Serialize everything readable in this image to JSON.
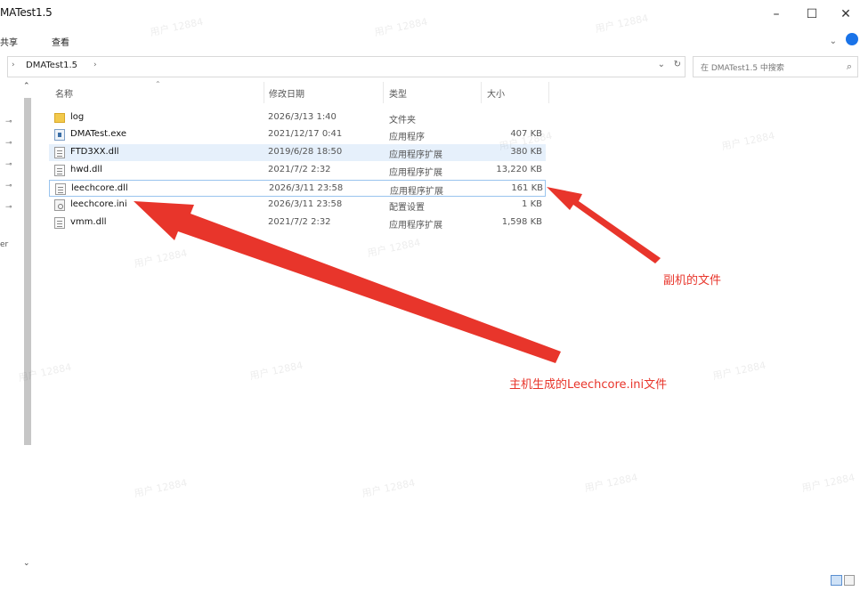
{
  "window": {
    "title": "MATest1.5",
    "minimize": "–",
    "maximize": "☐",
    "close": "✕"
  },
  "ribbon": {
    "tabs": [
      "共享",
      "查看"
    ],
    "expand": "⌄"
  },
  "address": {
    "arrow": "›",
    "path": "DMATest1.5",
    "crumb_arrow": "›",
    "dropdown": "⌄",
    "refresh": "↻"
  },
  "search": {
    "placeholder": "在 DMATest1.5 中搜索",
    "icon": "⌕"
  },
  "nav": {
    "pin": "⊸",
    "label": "er"
  },
  "scroll": {
    "up": "⌃",
    "down": "⌄"
  },
  "columns": {
    "name": "名称",
    "date": "修改日期",
    "type": "类型",
    "size": "大小",
    "sort": "⌃"
  },
  "files": [
    {
      "name": "log",
      "date": "2026/3/13 1:40",
      "type": "文件夹",
      "size": "",
      "icon": "folder-icon"
    },
    {
      "name": "DMATest.exe",
      "date": "2021/12/17 0:41",
      "type": "应用程序",
      "size": "407 KB",
      "icon": "exe-icon"
    },
    {
      "name": "FTD3XX.dll",
      "date": "2019/6/28 18:50",
      "type": "应用程序扩展",
      "size": "380 KB",
      "icon": "dll-icon"
    },
    {
      "name": "hwd.dll",
      "date": "2021/7/2 2:32",
      "type": "应用程序扩展",
      "size": "13,220 KB",
      "icon": "dll-icon"
    },
    {
      "name": "leechcore.dll",
      "date": "2026/3/11 23:58",
      "type": "应用程序扩展",
      "size": "161 KB",
      "icon": "dll-icon"
    },
    {
      "name": "leechcore.ini",
      "date": "2026/3/11 23:58",
      "type": "配置设置",
      "size": "1 KB",
      "icon": "ini-icon"
    },
    {
      "name": "vmm.dll",
      "date": "2021/7/2 2:32",
      "type": "应用程序扩展",
      "size": "1,598 KB",
      "icon": "dll-icon"
    }
  ],
  "annotations": {
    "slave_file": "副机的文件",
    "host_file": "主机生成的Leechcore.ini文件"
  },
  "watermark": "用户 12884",
  "colors": {
    "annotation": "#e8352b",
    "highlight_row": "#e6f0fb",
    "selection_border": "#99c4ee"
  }
}
